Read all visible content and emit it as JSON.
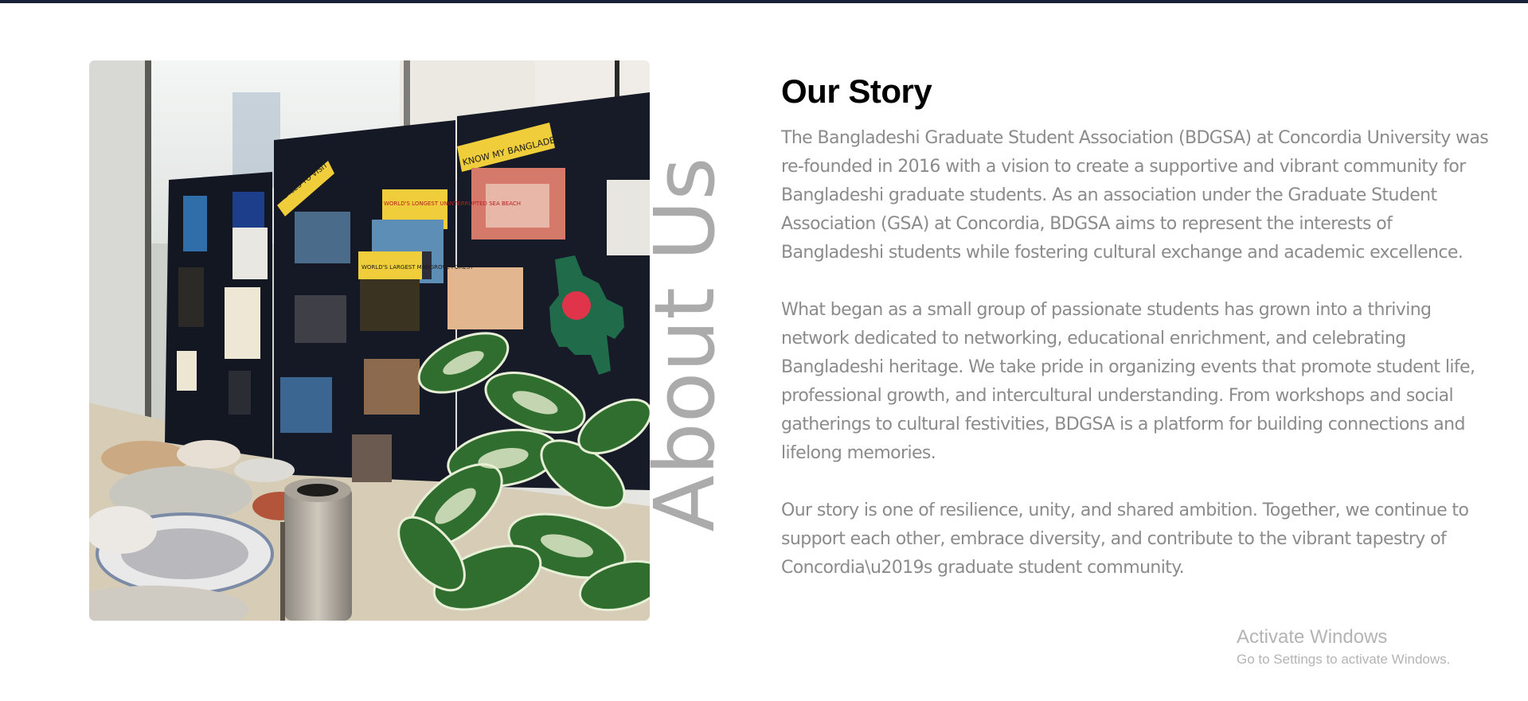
{
  "section": {
    "vertical_title": "About Us",
    "heading": "Our Story",
    "paragraphs": [
      "The Bangladeshi Graduate Student Association (BDGSA) at Concordia University was re-founded in 2016 with a vision to create a supportive and vibrant community for Bangladeshi graduate students. As an association under the Graduate Student Association (GSA) at Concordia, BDGSA aims to represent the interests of Bangladeshi students while fostering cultural exchange and academic excellence.",
      "What began as a small group of passionate students has grown into a thriving network dedicated to networking, educational enrichment, and celebrating Bangladeshi heritage. We take pride in organizing events that promote student life, professional growth, and intercultural understanding. From workshops and social gatherings to cultural festivities, BDGSA is a platform for building connections and lifelong memories.",
      "Our story is one of resilience, unity, and shared ambition. Together, we continue to support each other, embrace diversity, and contribute to the vibrant tapestry of Concordia\\u2019s graduate student community."
    ]
  },
  "photo": {
    "signs": {
      "places_to_visit": "PLACES TO VISIT",
      "longest_beach": "WORLD'S LONGEST UNINTERRUPTED SEA BEACH",
      "know_bangladesh": "KNOW MY BANGLADESH",
      "mangrove": "WORLD'S LARGEST MANGROVE FOREST"
    }
  },
  "windows_watermark": {
    "title": "Activate Windows",
    "subtitle": "Go to Settings to activate Windows."
  },
  "colors": {
    "top_bar": "#182138",
    "heading": "#000000",
    "body_text": "#8b8b8b",
    "vertical_title": "#ababab",
    "flag_green": "#1f6b4a",
    "flag_red": "#e0344a"
  }
}
